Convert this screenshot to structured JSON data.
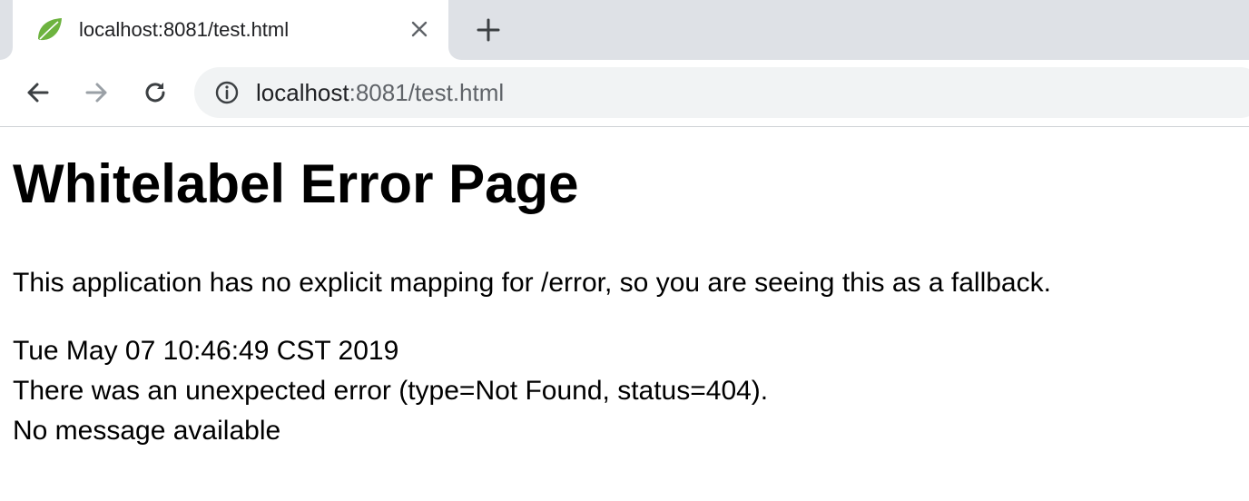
{
  "browser": {
    "tab": {
      "title": "localhost:8081/test.html",
      "favicon": "spring-leaf-icon"
    },
    "toolbar": {
      "back": "back-arrow-icon",
      "forward": "forward-arrow-icon",
      "reload": "reload-icon",
      "site_info": "info-icon",
      "url_host": "localhost",
      "url_rest": ":8081/test.html"
    },
    "colors": {
      "tabstrip": "#dee1e6",
      "omnibox": "#f1f3f4",
      "favicon_green": "#6db33f"
    }
  },
  "page": {
    "title": "Whitelabel Error Page",
    "description": "This application has no explicit mapping for /error, so you are seeing this as a fallback.",
    "timestamp": "Tue May 07 10:46:49 CST 2019",
    "error_line": "There was an unexpected error (type=Not Found, status=404).",
    "message": "No message available"
  }
}
